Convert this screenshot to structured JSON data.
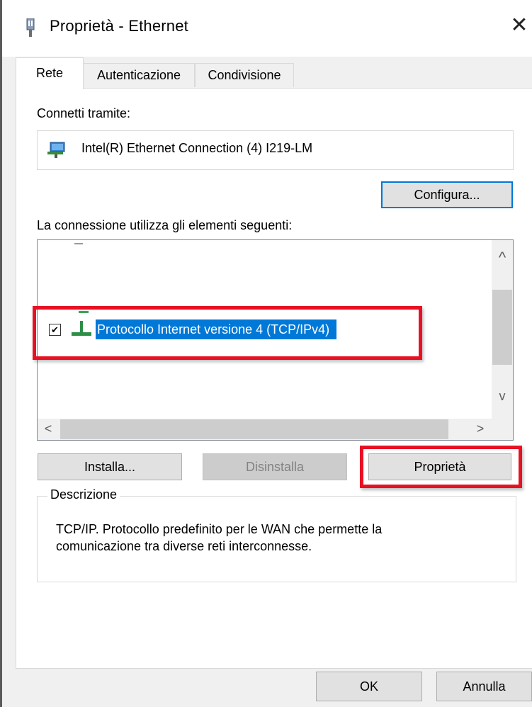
{
  "window": {
    "title": "Proprietà - Ethernet",
    "close_glyph": "✕"
  },
  "tabs": [
    {
      "label": "Rete",
      "active": true
    },
    {
      "label": "Autenticazione",
      "active": false
    },
    {
      "label": "Condivisione",
      "active": false
    }
  ],
  "connect_using": {
    "label": "Connetti tramite:",
    "adapter": "Intel(R) Ethernet Connection (4) I219-LM",
    "adapter_icon": "network-adapter-icon",
    "configure_button": "Configura..."
  },
  "items": {
    "label": "La connessione utilizza gli elementi seguenti:",
    "list": [
      {
        "label": "Protocollo Internet versione 4 (TCP/IPv4)",
        "checked": true,
        "selected": true,
        "icon": "protocol-icon"
      }
    ],
    "scroll_up": "^",
    "scroll_down": "v",
    "scroll_left": "<",
    "scroll_right": ">"
  },
  "buttons": {
    "install": "Installa...",
    "uninstall": "Disinstalla",
    "properties": "Proprietà",
    "ok": "OK",
    "cancel": "Annulla"
  },
  "description": {
    "legend": "Descrizione",
    "text_line1": "TCP/IP. Protocollo predefinito per le WAN che permette la",
    "text_line2": "comunicazione tra diverse reti interconnesse."
  },
  "colors": {
    "highlight": "#0078d7",
    "annotation_red": "#e81123",
    "dialog_background": "#f0f0f0"
  }
}
